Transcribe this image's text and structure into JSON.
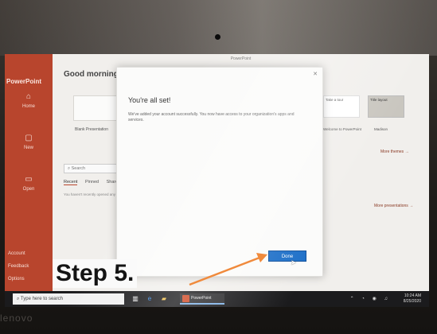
{
  "app": {
    "name": "PowerPoint",
    "window_title": "PowerPoint",
    "greeting": "Good morning"
  },
  "sidebar": {
    "items": [
      {
        "label": "Home",
        "icon": "home-icon"
      },
      {
        "label": "New",
        "icon": "new-file-icon"
      },
      {
        "label": "Open",
        "icon": "folder-open-icon"
      }
    ],
    "bottom": [
      {
        "label": "Account"
      },
      {
        "label": "Feedback"
      },
      {
        "label": "Options"
      }
    ]
  },
  "templates": {
    "blank": "Blank Presentation",
    "right": [
      {
        "thumb": "Take a tour",
        "label": "Welcome to PowerPoint"
      },
      {
        "thumb": "",
        "label": "Gallery"
      },
      {
        "thumb": "Title layout",
        "label": "Madison"
      }
    ],
    "more_themes": "More themes →"
  },
  "search": {
    "placeholder": "Search"
  },
  "tabs": [
    "Recent",
    "Pinned",
    "Shared with Me"
  ],
  "recent_empty": "You haven't recently opened any presentations.",
  "more_presentations": "More presentations →",
  "dialog": {
    "title": "You're all set!",
    "body": "We've added your account successfully. You now have access to your organization's apps and services.",
    "done_label": "Done",
    "close_glyph": "✕"
  },
  "taskbar": {
    "search_placeholder": "Type here to search",
    "app_label": "PowerPoint",
    "time": "10:24 AM",
    "date": "8/25/2020"
  },
  "annotation": {
    "step": "Step 5.",
    "arrow_color": "#f08a3c"
  },
  "bezel": {
    "brand": "lenovo"
  }
}
